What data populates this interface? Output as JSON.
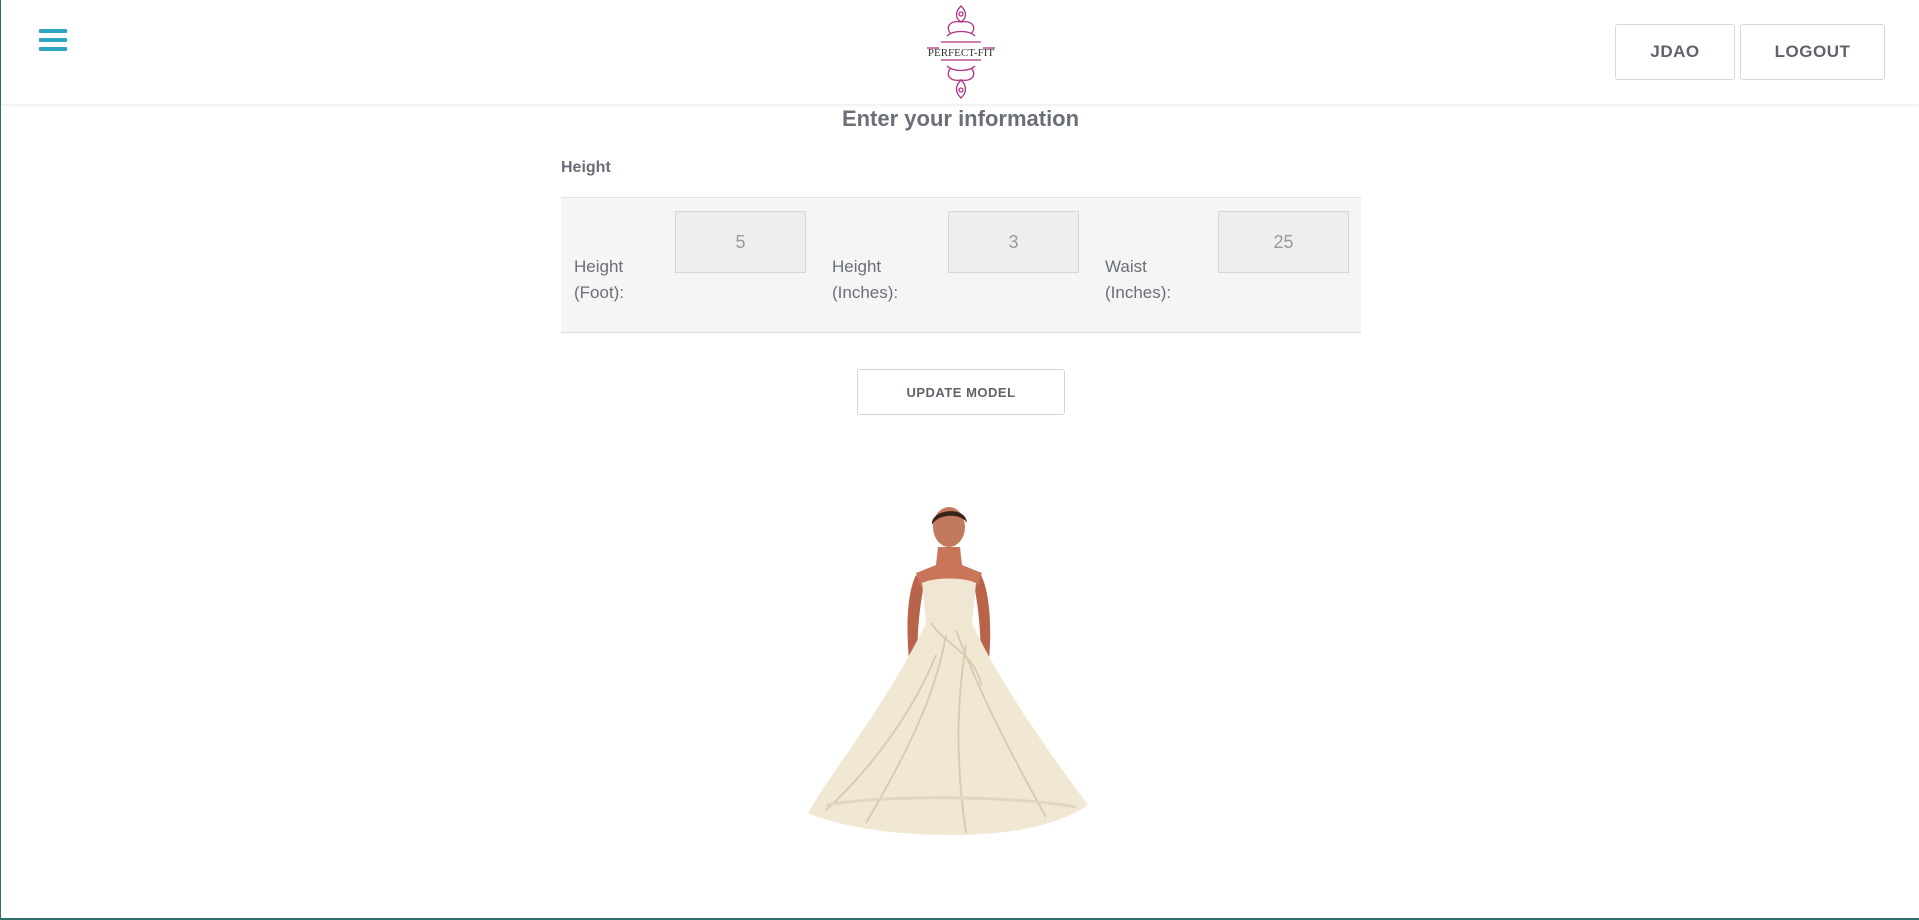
{
  "header": {
    "menu_icon": "hamburger-menu-icon",
    "logo_text": "PERFECT-FIT",
    "user_button": "JDAO",
    "logout_button": "LOGOUT"
  },
  "main": {
    "title": "Enter your information",
    "section_label": "Height",
    "fields": [
      {
        "label_line1": "Height",
        "label_line2": "(Foot):",
        "value": "5"
      },
      {
        "label_line1": "Height",
        "label_line2": "(Inches):",
        "value": "3"
      },
      {
        "label_line1": "Waist",
        "label_line2": "(Inches):",
        "value": "25"
      }
    ],
    "update_button": "UPDATE MODEL"
  },
  "colors": {
    "accent": "#2ea3c2",
    "logo": "#b0338a",
    "text": "#6b6f78"
  }
}
